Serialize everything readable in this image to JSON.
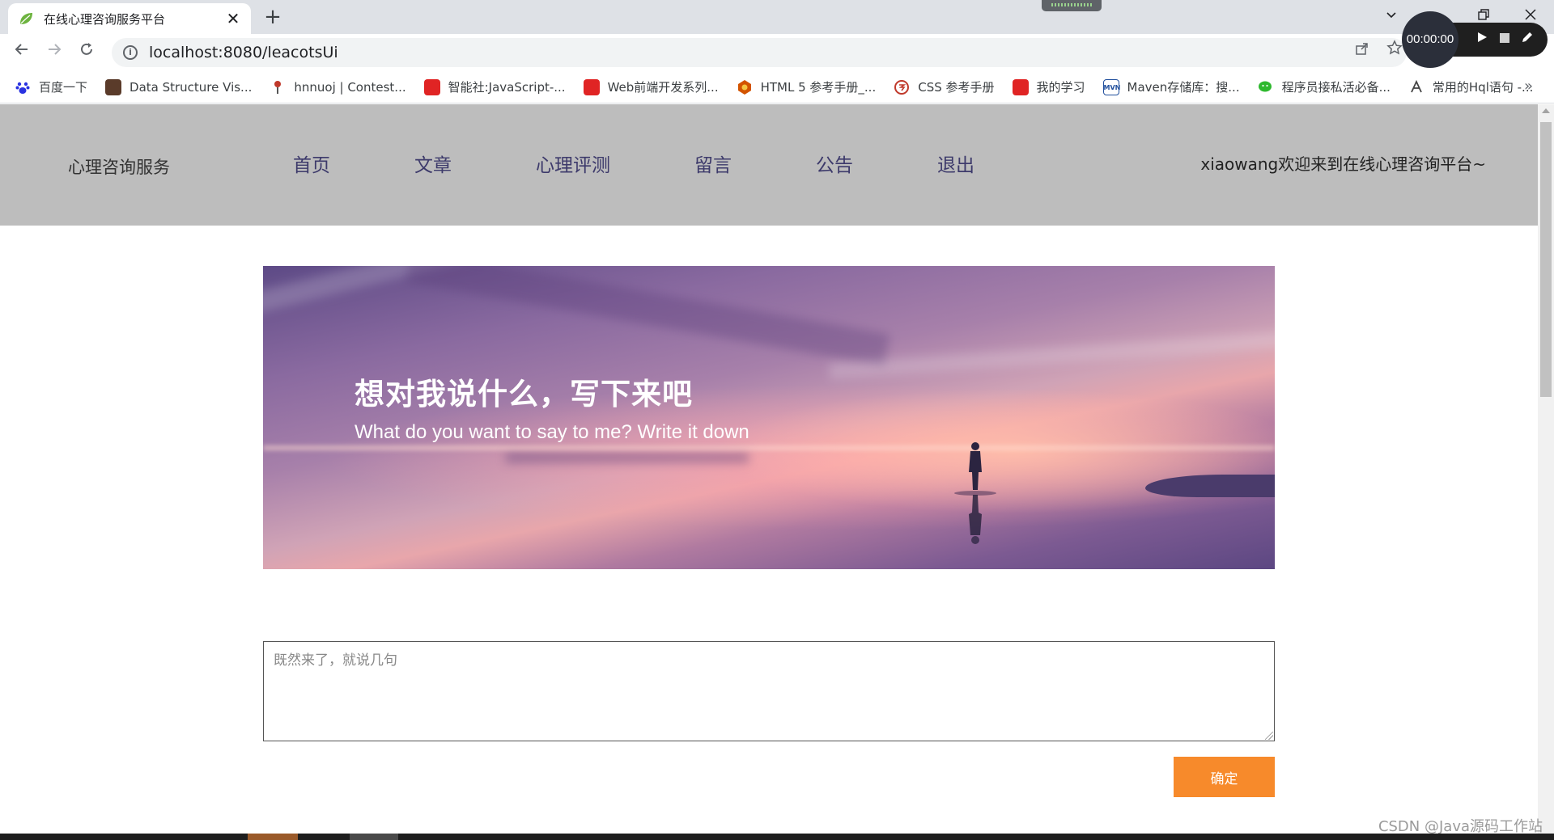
{
  "browser": {
    "tab_title": "在线心理咨询服务平台",
    "tab_close": "✕",
    "new_tab": "+",
    "url": "localhost:8080/leacotsUi",
    "bookmarks": [
      {
        "label": "百度一下",
        "color": "#2932e1"
      },
      {
        "label": "Data Structure Vis...",
        "color": "#5a3b2a"
      },
      {
        "label": "hnnuoj | Contest...",
        "color": "#c0392b"
      },
      {
        "label": "智能社:JavaScript-...",
        "color": "#e02424"
      },
      {
        "label": "Web前端开发系列...",
        "color": "#e02424"
      },
      {
        "label": "HTML 5 参考手册_...",
        "color": "#d35400"
      },
      {
        "label": "CSS 参考手册",
        "color": "#c0392b"
      },
      {
        "label": "我的学习",
        "color": "#e02424"
      },
      {
        "label": "Maven存储库：搜...",
        "color": "#1f4e9c"
      },
      {
        "label": "程序员接私活必备...",
        "color": "#2eb82e"
      },
      {
        "label": "常用的Hql语句 -...",
        "color": "#444444"
      }
    ],
    "bookmarks_more": "»"
  },
  "recorder": {
    "time": "00:00:00"
  },
  "site": {
    "brand": "心理咨询服务",
    "nav": [
      "首页",
      "文章",
      "心理评测",
      "留言",
      "公告",
      "退出"
    ],
    "welcome": "xiaowang欢迎来到在线心理咨询平台~"
  },
  "banner": {
    "title": "想对我说什么，写下来吧",
    "subtitle": "What do you want to say to me? Write it down"
  },
  "message_form": {
    "placeholder": "既然来了，就说几句",
    "submit_label": "确定"
  },
  "watermark": "CSDN @Java源码工作站"
}
